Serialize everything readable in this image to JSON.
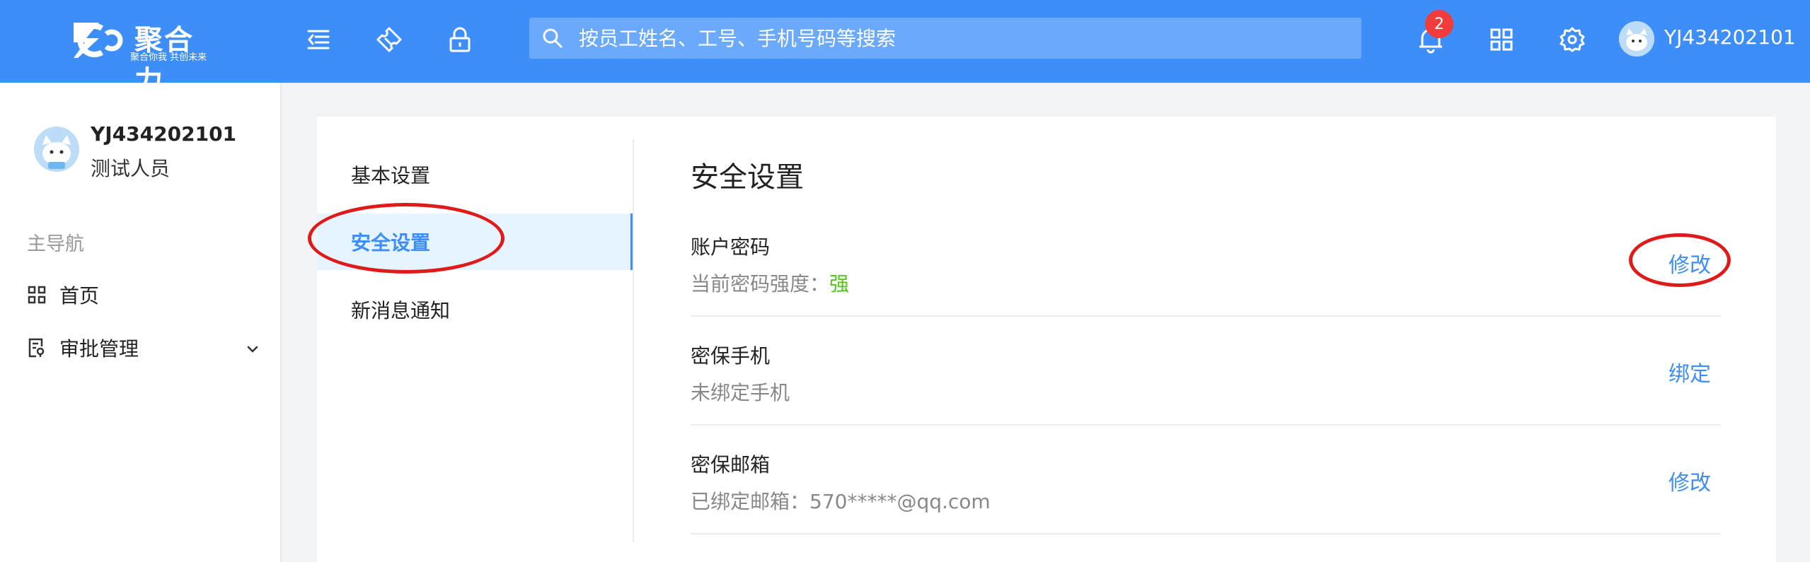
{
  "header": {
    "logo_text": "聚合力",
    "logo_slogan": "聚合你我 共创未来",
    "search_placeholder": "按员工姓名、工号、手机号码等搜索",
    "notification_count": "2",
    "username": "YJ434202101"
  },
  "sidebar": {
    "name": "YJ434202101",
    "role": "测试人员",
    "section_label": "主导航",
    "items": [
      {
        "label": "首页",
        "icon": "grid-icon"
      },
      {
        "label": "审批管理",
        "icon": "approval-icon"
      }
    ]
  },
  "settings_menu": {
    "items": [
      {
        "label": "基本设置"
      },
      {
        "label": "安全设置",
        "active": true
      },
      {
        "label": "新消息通知"
      }
    ]
  },
  "security": {
    "title": "安全设置",
    "rows": [
      {
        "title": "账户密码",
        "desc_prefix": "当前密码强度：",
        "desc_value": "强",
        "action": "修改"
      },
      {
        "title": "密保手机",
        "desc_prefix": "未绑定手机",
        "desc_value": "",
        "action": "绑定"
      },
      {
        "title": "密保邮箱",
        "desc_prefix": "已绑定邮箱：570*****@qq.com",
        "desc_value": "",
        "action": "修改"
      }
    ]
  },
  "colors": {
    "header_bg": "#3d8ef8",
    "accent": "#3d8ef8",
    "strength_green": "#52c41a",
    "annotation_red": "#e01919",
    "badge_red": "#f23b3b"
  }
}
